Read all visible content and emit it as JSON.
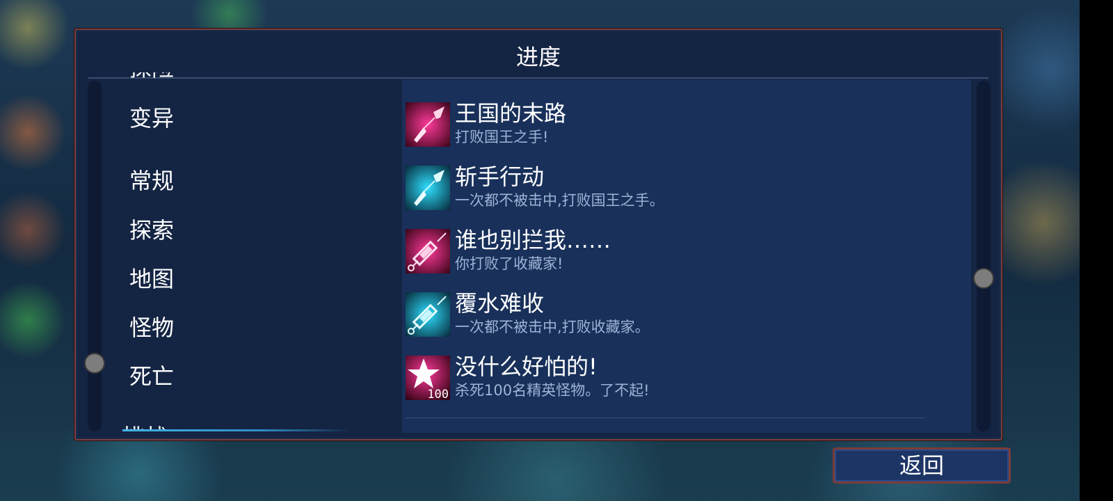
{
  "panel": {
    "title": "进度"
  },
  "categories": {
    "partial_top": "探险",
    "items": [
      {
        "label": "变异"
      },
      {
        "label": "常规"
      },
      {
        "label": "探索"
      },
      {
        "label": "地图"
      },
      {
        "label": "怪物"
      },
      {
        "label": "死亡"
      }
    ],
    "partial_bottom": "挑战"
  },
  "achievements": [
    {
      "title": "王国的末路",
      "desc": "打败国王之手!",
      "icon": "dagger-icon",
      "color": "#e0157a"
    },
    {
      "title": "斩手行动",
      "desc": "一次都不被击中,打败国王之手。",
      "icon": "dagger-icon",
      "color": "#22c7e8"
    },
    {
      "title": "谁也别拦我……",
      "desc": "你打败了收藏家!",
      "icon": "syringe-icon",
      "color": "#e0157a"
    },
    {
      "title": "覆水难收",
      "desc": "一次都不被击中,打败收藏家。",
      "icon": "syringe-icon",
      "color": "#22c7e8"
    },
    {
      "title": "没什么好怕的!",
      "desc": "杀死100名精英怪物。了不起!",
      "icon": "star-icon",
      "color": "#e0157a",
      "icon_badge": "100"
    }
  ],
  "buttons": {
    "back": "返回"
  }
}
